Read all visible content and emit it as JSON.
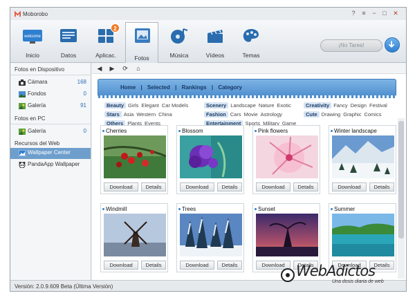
{
  "app": {
    "title": "Moborobo"
  },
  "window_controls": {
    "help": "?",
    "menu": "≡",
    "minimize": "−",
    "maximize": "□",
    "close": "✕"
  },
  "toolbar": {
    "items": [
      {
        "label": "Inicio",
        "icon": "welcome-icon",
        "icon_text": "welcome"
      },
      {
        "label": "Datos",
        "icon": "data-card-icon"
      },
      {
        "label": "Aplicac.",
        "icon": "apps-grid-icon",
        "badge": "2"
      },
      {
        "label": "Fotos",
        "icon": "photo-frame-icon"
      },
      {
        "label": "Música",
        "icon": "music-disc-icon"
      },
      {
        "label": "Vídeos",
        "icon": "clapperboard-icon"
      },
      {
        "label": "Temas",
        "icon": "palette-icon"
      }
    ],
    "task_status": "¡No Tarea!"
  },
  "sidebar": {
    "section_device": "Fotos en Dispositivo",
    "device_items": [
      {
        "label": "Cámara",
        "count": "168"
      },
      {
        "label": "Fondos",
        "count": "0"
      },
      {
        "label": "Galería",
        "count": "91"
      }
    ],
    "section_pc": "Fotos en PC",
    "pc_items": [
      {
        "label": "Galería",
        "count": "0"
      }
    ],
    "section_web": "Recursos del Web",
    "web_items": [
      {
        "label": "Wallpaper Center"
      },
      {
        "label": "PandaApp Wallpaper"
      }
    ]
  },
  "wallpaper_nav": {
    "links": [
      "Home",
      "Selected",
      "Rankings",
      "Category"
    ],
    "separator": "|"
  },
  "tags": [
    {
      "category": "Beauty",
      "links": [
        "Girls",
        "Elegant",
        "Car Models"
      ]
    },
    {
      "category": "Scenery",
      "links": [
        "Landscape",
        "Nature",
        "Exotic"
      ]
    },
    {
      "category": "Creativity",
      "links": [
        "Fancy",
        "Design",
        "Festival"
      ]
    },
    {
      "category": "Stars",
      "links": [
        "Asia",
        "Western",
        "China"
      ]
    },
    {
      "category": "Fashion",
      "links": [
        "Cars",
        "Movie",
        "Astrology"
      ]
    },
    {
      "category": "Cute",
      "links": [
        "Drawing",
        "Graphic",
        "Comics"
      ]
    },
    {
      "category": "Others",
      "links": [
        "Plants",
        "Events"
      ]
    },
    {
      "category": "Entertainment",
      "links": [
        "Sports",
        "Military",
        "Game"
      ]
    }
  ],
  "cards": [
    {
      "title": "Cherries"
    },
    {
      "title": "Blossom"
    },
    {
      "title": "Pink flowers"
    },
    {
      "title": "Winter landscape"
    },
    {
      "title": "Windmill"
    },
    {
      "title": "Trees"
    },
    {
      "title": "Sunset"
    },
    {
      "title": "Summer"
    }
  ],
  "card_buttons": {
    "download": "Download",
    "details": "Details"
  },
  "status": {
    "version": "Versión: 2.0.9.609 Beta  (Última Versión)"
  },
  "watermark": {
    "name": "WebAdictos",
    "tagline": "Una dosis diaria de web"
  },
  "colors": {
    "accent": "#4f8fcf",
    "selected_sidebar": "#6e9fcc",
    "badge": "#f07a24",
    "count_blue": "#2f6fb8"
  }
}
